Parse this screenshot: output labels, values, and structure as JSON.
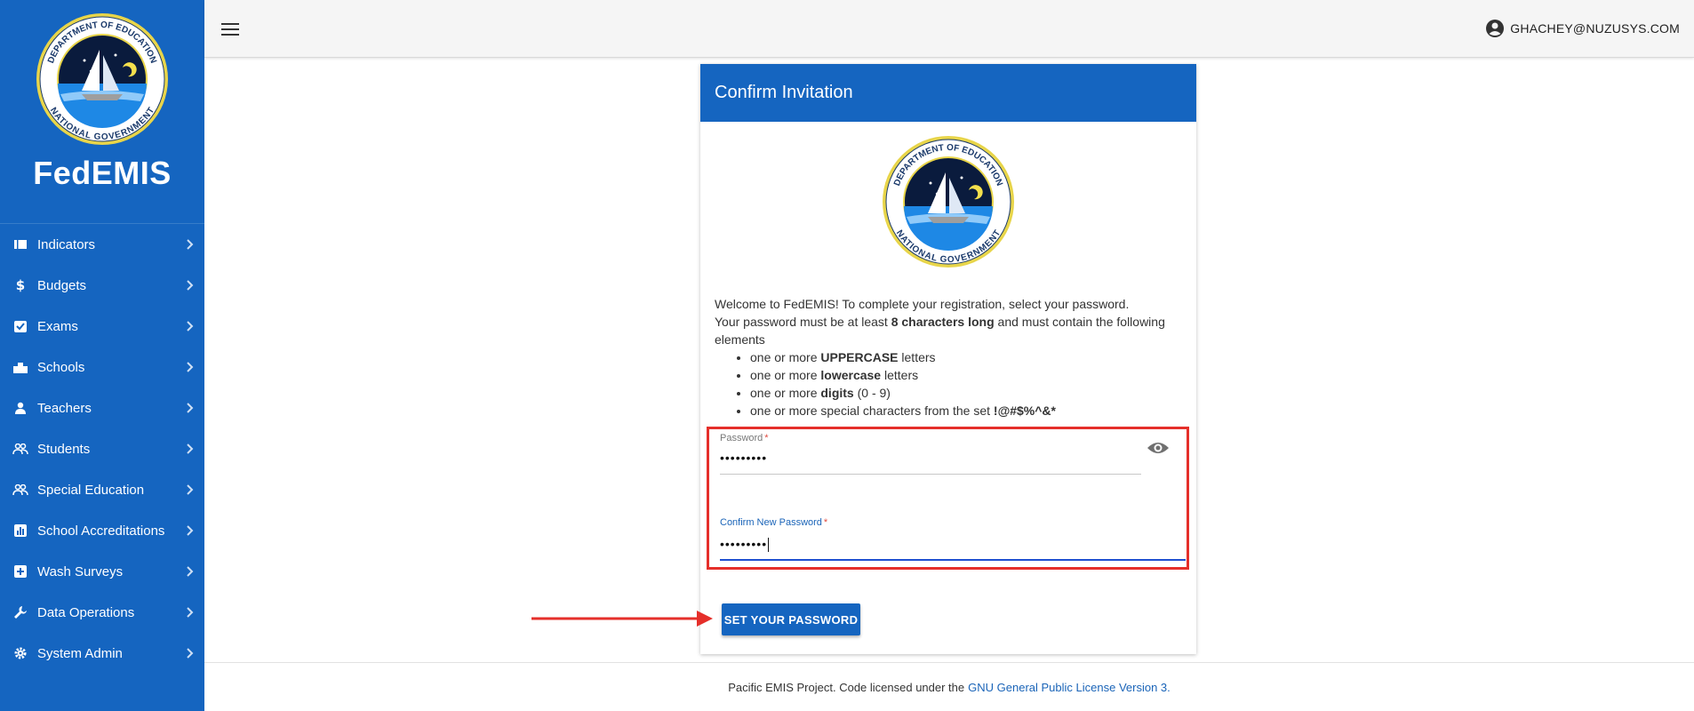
{
  "app": {
    "brand": "FedEMIS"
  },
  "sidebar": {
    "items": [
      {
        "label": "Indicators",
        "icon": "indicators-icon"
      },
      {
        "label": "Budgets",
        "icon": "dollar-icon"
      },
      {
        "label": "Exams",
        "icon": "checklist-icon"
      },
      {
        "label": "Schools",
        "icon": "school-building-icon"
      },
      {
        "label": "Teachers",
        "icon": "person-icon"
      },
      {
        "label": "Students",
        "icon": "people-icon"
      },
      {
        "label": "Special Education",
        "icon": "people-icon"
      },
      {
        "label": "School Accreditations",
        "icon": "bar-chart-icon"
      },
      {
        "label": "Wash Surveys",
        "icon": "medical-plus-icon"
      },
      {
        "label": "Data Operations",
        "icon": "wrench-icon"
      },
      {
        "label": "System Admin",
        "icon": "gear-icon"
      }
    ]
  },
  "header": {
    "user": "GHACHEY@NUZUSYS.COM"
  },
  "card": {
    "title": "Confirm Invitation",
    "seal_text_top": "DEPARTMENT OF EDUCATION",
    "seal_text_bottom": "NATIONAL GOVERNMENT",
    "intro_line1": "Welcome to FedEMIS! To complete your registration, select your password.",
    "intro_line2a": "Your password must be at least ",
    "intro_line2b": "8 characters long",
    "intro_line2c": " and must contain the following elements",
    "rules": [
      {
        "pre": "one or more ",
        "bold": "UPPERCASE",
        "post": " letters"
      },
      {
        "pre": "one or more ",
        "bold": "lowercase",
        "post": " letters"
      },
      {
        "pre": "one or more ",
        "bold": "digits",
        "post": " (0 - 9)"
      },
      {
        "pre": "one or more special characters from the set ",
        "bold": "!@#$%^&*",
        "post": ""
      }
    ],
    "password_label": "Password",
    "password_value": "•••••••••",
    "confirm_label": "Confirm New Password",
    "confirm_value": "•••••••••",
    "required_mark": "*",
    "button": "SET YOUR PASSWORD"
  },
  "footer": {
    "text": "Pacific EMIS Project. Code licensed under the",
    "link": "GNU General Public License Version 3."
  },
  "colors": {
    "primary": "#1565c0",
    "annotation": "#e52f2a"
  }
}
